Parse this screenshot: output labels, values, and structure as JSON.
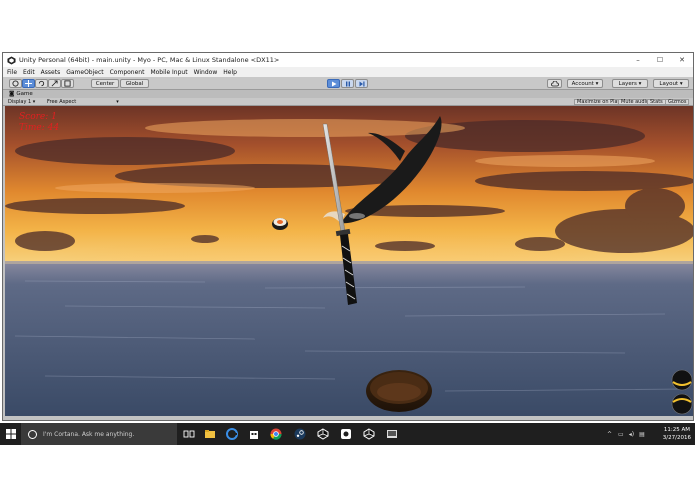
{
  "window": {
    "title": "Unity Personal (64bit) - main.unity - Myo - PC, Mac & Linux Standalone <DX11>",
    "controls": {
      "minimize": "–",
      "maximize": "☐",
      "close": "✕"
    }
  },
  "menu": [
    "File",
    "Edit",
    "Assets",
    "GameObject",
    "Component",
    "Mobile Input",
    "Window",
    "Help"
  ],
  "toolbar": {
    "center": "Center",
    "global": "Global",
    "account": "Account",
    "layers": "Layers",
    "layout": "Layout"
  },
  "game_panel": {
    "tab": "Game",
    "display": "Display 1",
    "aspect": "Free Aspect",
    "maximize_on_play": "Maximize on Play",
    "mute_audio": "Mute audio",
    "stats": "Stats",
    "gizmos": "Gizmos"
  },
  "hud": {
    "line1": "Score: 1",
    "line2": "Time: 44"
  },
  "taskbar": {
    "cortana_placeholder": "I'm Cortana. Ask me anything.",
    "time": "11:25 AM",
    "date": "3/27/2016"
  },
  "colors": {
    "sky_top": "#7a3c2a",
    "sky_glow": "#f5a030",
    "sea": "#4a5a78",
    "hud_text": "#e02020",
    "play_accent": "#5d8ed8",
    "taskbar": "#1f1f1f"
  },
  "icons": [
    "unity-logo-icon",
    "hand-tool-icon",
    "move-tool-icon",
    "rotate-tool-icon",
    "scale-tool-icon",
    "rect-tool-icon",
    "play-icon",
    "pause-icon",
    "step-icon",
    "cloud-icon",
    "windows-start-icon",
    "cortana-icon",
    "task-view-icon",
    "file-explorer-icon",
    "edge-icon",
    "store-icon",
    "chrome-icon",
    "steam-icon",
    "unity-icon",
    "myo-icon"
  ]
}
